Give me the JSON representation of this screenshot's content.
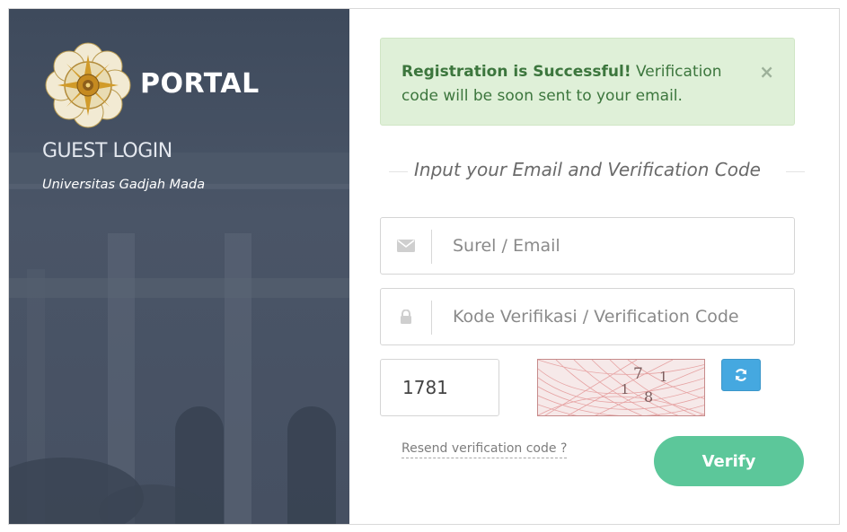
{
  "brand": {
    "title": "PORTAL",
    "subtitle": "GUEST LOGIN",
    "institution": "Universitas Gadjah Mada",
    "logo_icon": "ugm-seal-icon"
  },
  "alert": {
    "strong": "Registration is Successful!",
    "message": " Verification code will be soon sent to your email.",
    "close_label": "×",
    "background": "#dff0d8",
    "text_color": "#3c763d"
  },
  "form": {
    "heading": "Input your Email and Verification Code",
    "email": {
      "placeholder": "Surel / Email",
      "value": "",
      "icon": "envelope-icon"
    },
    "code": {
      "placeholder": "Kode Verifikasi / Verification Code",
      "value": "",
      "icon": "lock-icon"
    },
    "captcha": {
      "value": "1781",
      "image_digits": [
        "1",
        "7",
        "1",
        "8"
      ],
      "refresh_icon": "refresh-icon"
    },
    "resend_label": "Resend verification code ?",
    "verify_label": "Verify"
  },
  "colors": {
    "accent_green": "#5cc79a",
    "refresh_blue": "#45a8e0",
    "left_panel": "#465062"
  }
}
